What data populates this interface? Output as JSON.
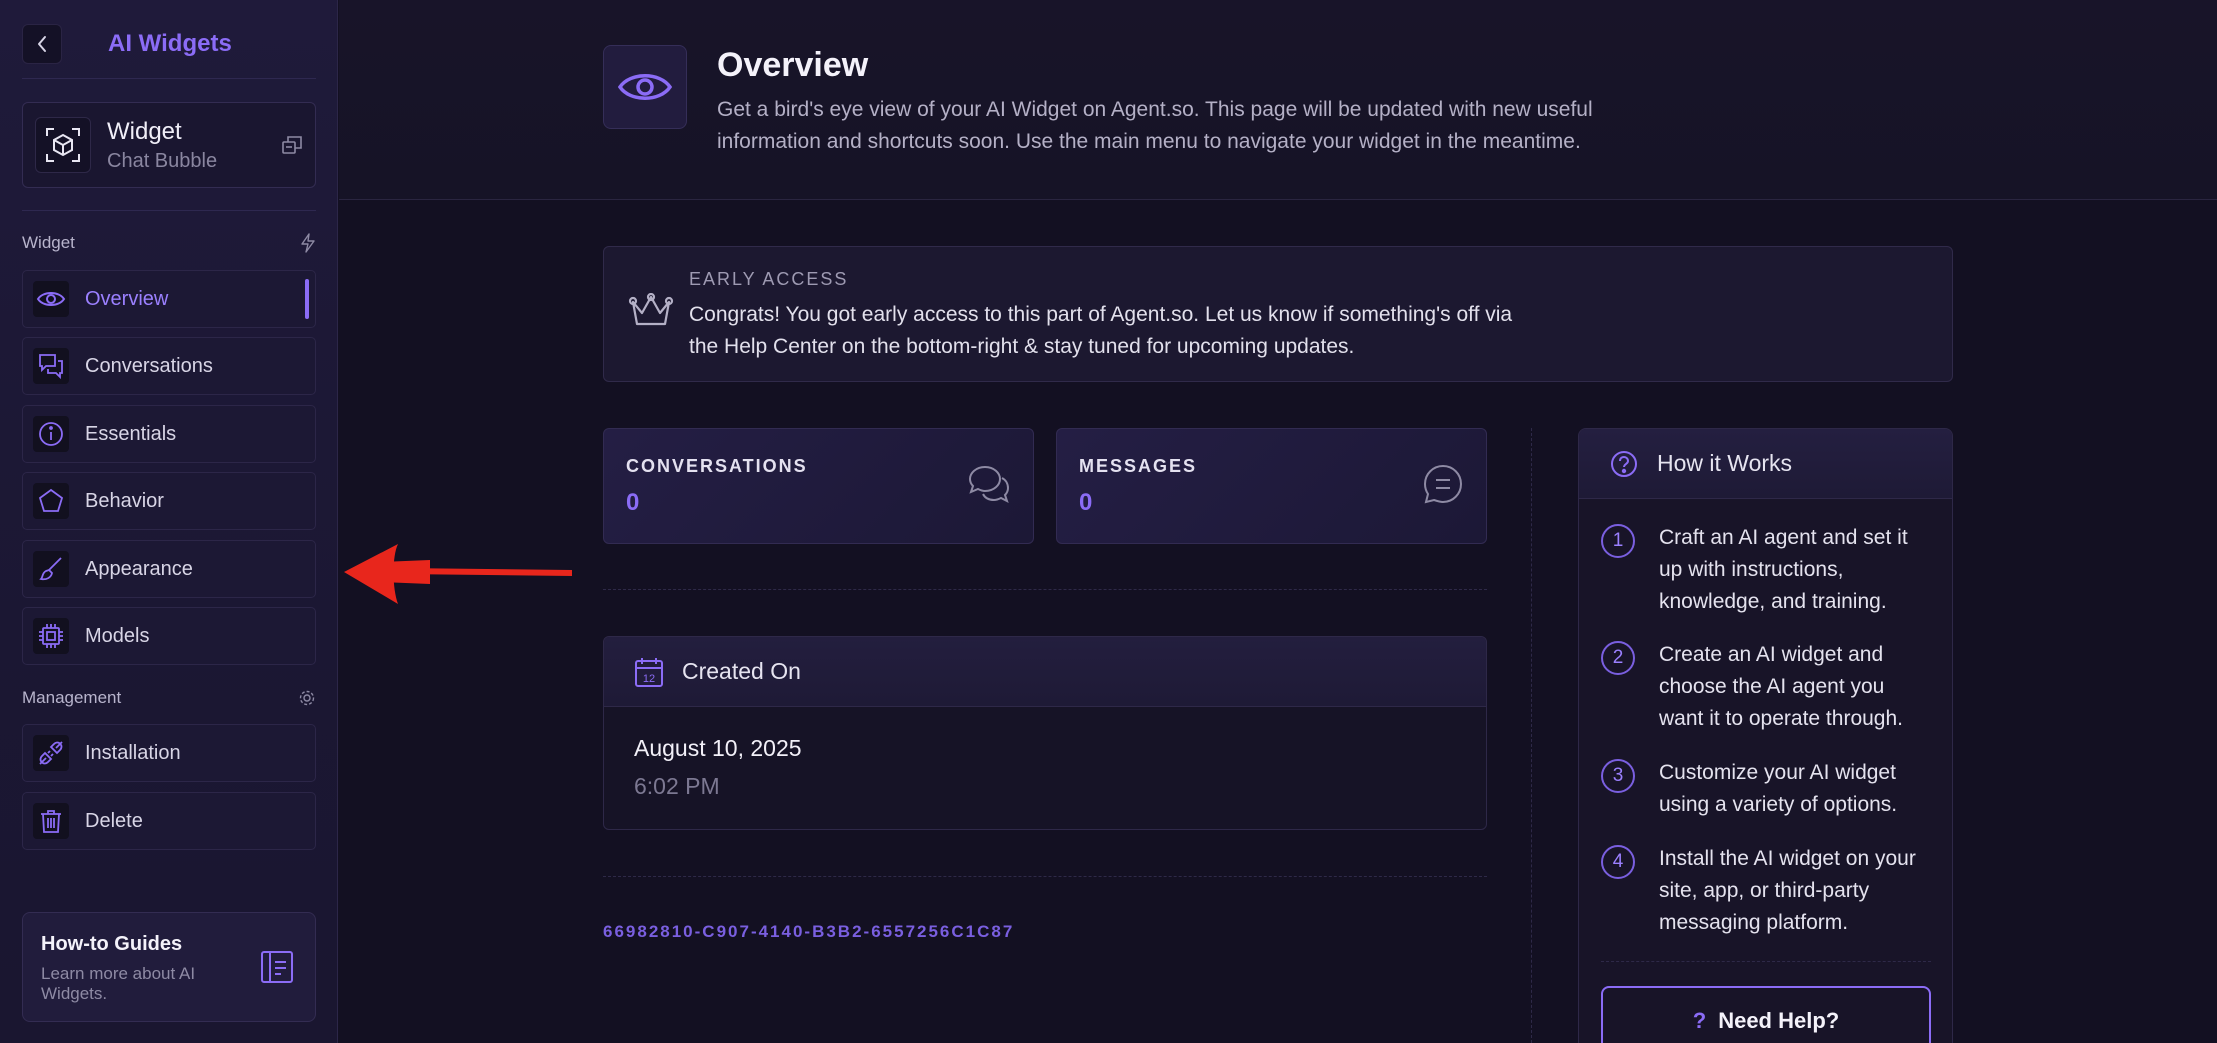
{
  "sidebar": {
    "title": "AI Widgets",
    "widget": {
      "name": "Widget",
      "type": "Chat Bubble"
    },
    "sections": [
      {
        "label": "Widget",
        "icon": "bolt-icon"
      },
      {
        "label": "Management",
        "icon": "gear-icon"
      }
    ],
    "items": [
      {
        "label": "Overview",
        "icon": "eye-icon",
        "active": true
      },
      {
        "label": "Conversations",
        "icon": "chat-bubbles-icon"
      },
      {
        "label": "Essentials",
        "icon": "info-icon"
      },
      {
        "label": "Behavior",
        "icon": "pentagon-icon"
      },
      {
        "label": "Appearance",
        "icon": "brush-icon"
      },
      {
        "label": "Models",
        "icon": "cpu-icon"
      },
      {
        "label": "Installation",
        "icon": "plug-icon"
      },
      {
        "label": "Delete",
        "icon": "trash-icon"
      }
    ],
    "guides": {
      "title": "How-to Guides",
      "desc": "Learn more about AI Widgets."
    }
  },
  "header": {
    "title": "Overview",
    "desc": "Get a bird's eye view of your AI Widget on Agent.so. This page will be updated with new useful information and shortcuts soon. Use the main menu to navigate your widget in the meantime."
  },
  "early_access": {
    "label": "EARLY ACCESS",
    "message": "Congrats! You got early access to this part of Agent.so. Let us know if something's off via the Help Center on the bottom-right & stay tuned for upcoming updates."
  },
  "stats": [
    {
      "label": "CONVERSATIONS",
      "value": "0"
    },
    {
      "label": "MESSAGES",
      "value": "0"
    }
  ],
  "created": {
    "title": "Created On",
    "date": "August 10, 2025",
    "time": "6:02 PM",
    "icon_day": "12"
  },
  "uuid": "66982810-C907-4140-B3B2-6557256C1C87",
  "how_it_works": {
    "title": "How it Works",
    "steps": [
      {
        "num": "1",
        "text": "Craft an AI agent and set it up with instructions, knowledge, and training."
      },
      {
        "num": "2",
        "text": "Create an AI widget and choose the AI agent you want it to operate through."
      },
      {
        "num": "3",
        "text": "Customize your AI widget using a variety of options."
      },
      {
        "num": "4",
        "text": "Install the AI widget on your site, app, or third-party messaging platform."
      }
    ],
    "help_label": "Need Help?"
  },
  "colors": {
    "accent": "#8b6cf6",
    "background": "#131022",
    "sidebar": "#1f1a3a",
    "annotation_arrow": "#e8261c"
  }
}
